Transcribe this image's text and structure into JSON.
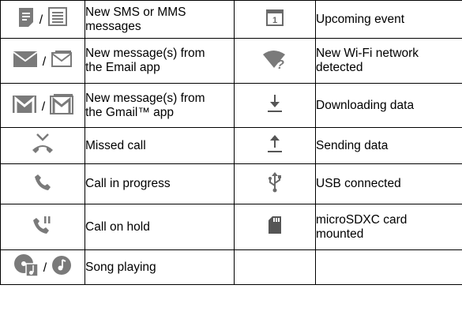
{
  "rows": [
    {
      "left": {
        "icons": [
          "sms-icon",
          "sms-outline-icon"
        ],
        "separator": "/",
        "text": "New SMS or MMS\nmessages"
      },
      "right": {
        "icons": [
          "calendar-icon"
        ],
        "text": "Upcoming event"
      }
    },
    {
      "left": {
        "icons": [
          "email-icon",
          "email-outline-icon"
        ],
        "separator": "/",
        "text": "New message(s) from\nthe Email app"
      },
      "right": {
        "icons": [
          "wifi-question-icon"
        ],
        "text": "New Wi-Fi network\ndetected"
      }
    },
    {
      "left": {
        "icons": [
          "gmail-icon",
          "gmail-outline-icon"
        ],
        "separator": "/",
        "text": "New message(s) from\nthe Gmail™ app"
      },
      "right": {
        "icons": [
          "download-icon"
        ],
        "text": "Downloading data"
      }
    },
    {
      "left": {
        "icons": [
          "missed-call-icon"
        ],
        "text": "Missed call"
      },
      "right": {
        "icons": [
          "upload-icon"
        ],
        "text": "Sending data"
      }
    },
    {
      "left": {
        "icons": [
          "call-icon"
        ],
        "text": "Call in progress"
      },
      "right": {
        "icons": [
          "usb-icon"
        ],
        "text": "USB connected"
      }
    },
    {
      "left": {
        "icons": [
          "call-hold-icon"
        ],
        "text": "Call on hold"
      },
      "right": {
        "icons": [
          "sd-card-icon"
        ],
        "text": "microSDXC card\nmounted"
      }
    },
    {
      "left": {
        "icons": [
          "music-note-disc-icon",
          "music-note-icon"
        ],
        "separator": "/",
        "text": "Song playing"
      },
      "right": {
        "icons": [],
        "text": ""
      }
    }
  ],
  "colors": {
    "icon_gray": "#7a7a7a",
    "icon_dark": "#555555",
    "border": "#000000",
    "text": "#000000"
  }
}
